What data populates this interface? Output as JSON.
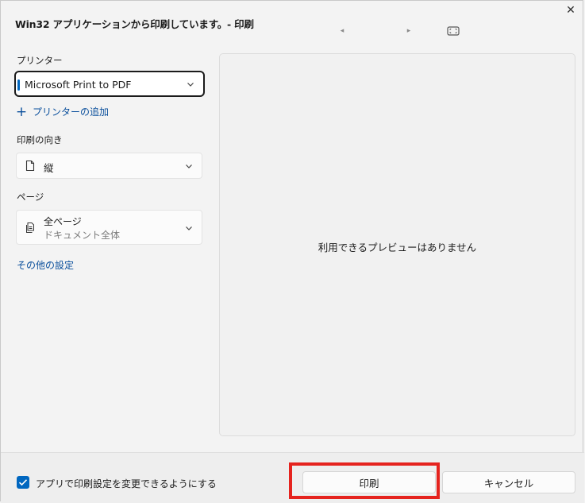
{
  "window": {
    "title": "Win32 アプリケーションから印刷しています。- 印刷",
    "close_glyph": "✕"
  },
  "preview_nav": {
    "prev_glyph": "◂",
    "next_glyph": "▸"
  },
  "printer": {
    "label": "プリンター",
    "selected": "Microsoft Print to PDF",
    "add_printer": "プリンターの追加",
    "plus_glyph": "+"
  },
  "orientation": {
    "label": "印刷の向き",
    "selected": "縦"
  },
  "pages": {
    "label": "ページ",
    "selected": "全ページ",
    "description": "ドキュメント全体"
  },
  "more_settings": "その他の設定",
  "preview": {
    "message": "利用できるプレビューはありません"
  },
  "footer": {
    "checkbox_label": "アプリで印刷設定を変更できるようにする",
    "checkbox_checked": true,
    "print_button": "印刷",
    "cancel_button": "キャンセル"
  },
  "colors": {
    "accent": "#0067c0",
    "link": "#0a4f9c",
    "highlight": "#e5231e"
  }
}
